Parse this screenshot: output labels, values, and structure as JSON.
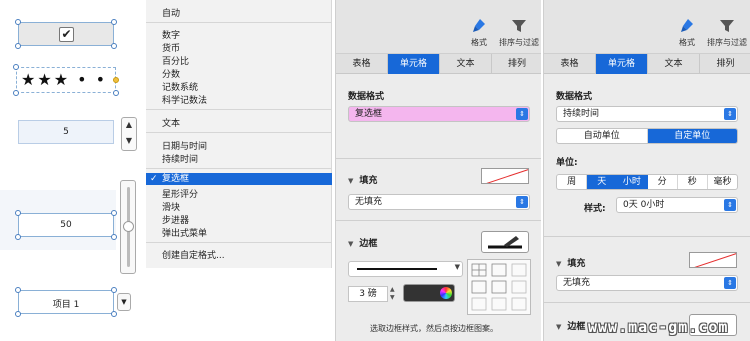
{
  "canvas": {
    "checkbox_glyph": "✔",
    "stars_glyph": "★★★ • •",
    "stepper_value": "5",
    "slider_value": "50",
    "popup_value": "项目 1",
    "stepper_up": "▲",
    "stepper_down": "▼",
    "popup_arrow": "▼"
  },
  "menu": {
    "items": [
      {
        "label": "自动"
      },
      {
        "label": "数字"
      },
      {
        "label": "货币"
      },
      {
        "label": "百分比"
      },
      {
        "label": "分数"
      },
      {
        "label": "记数系统"
      },
      {
        "label": "科学记数法"
      },
      {
        "label": "文本"
      },
      {
        "label": "日期与时间"
      },
      {
        "label": "持续时间"
      },
      {
        "label": "复选框",
        "checked": true,
        "check_glyph": "✓"
      },
      {
        "label": "星形评分"
      },
      {
        "label": "滑块"
      },
      {
        "label": "步进器"
      },
      {
        "label": "弹出式菜单"
      },
      {
        "label": "创建自定格式..."
      }
    ]
  },
  "panel1": {
    "toolbar": {
      "format_label": "格式",
      "sort_filter_label": "排序与过滤"
    },
    "tabs": [
      "表格",
      "单元格",
      "文本",
      "排列"
    ],
    "selected_tab": "单元格",
    "data_format_label": "数据格式",
    "data_format_value": "复选框",
    "fill_header": "填充",
    "fill_value": "无填充",
    "border_header": "边框",
    "border_size": "3 磅",
    "border_hint": "选取边框样式，然后点按边框图案。"
  },
  "panel2": {
    "toolbar": {
      "format_label": "格式",
      "sort_filter_label": "排序与过滤"
    },
    "tabs": [
      "表格",
      "单元格",
      "文本",
      "排列"
    ],
    "selected_tab": "单元格",
    "data_format_label": "数据格式",
    "data_format_value": "持续时间",
    "unit_toggle": [
      "自动单位",
      "自定单位"
    ],
    "unit_toggle_selected": "自定单位",
    "unit_label": "单位:",
    "units": [
      "周",
      "天",
      "小时",
      "分",
      "秒",
      "毫秒"
    ],
    "units_selected": [
      "天",
      "小时"
    ],
    "style_label": "样式:",
    "style_value": "0天 0小时",
    "fill_header": "填充",
    "fill_value": "无填充",
    "border_header": "边框"
  },
  "watermark": "www.mac-gm.com",
  "colors": {
    "accent": "#1768d8",
    "highlight_popup": "#f4b6ee",
    "menu_bg": "#f2f2f2",
    "panel_bg": "#ececec"
  }
}
